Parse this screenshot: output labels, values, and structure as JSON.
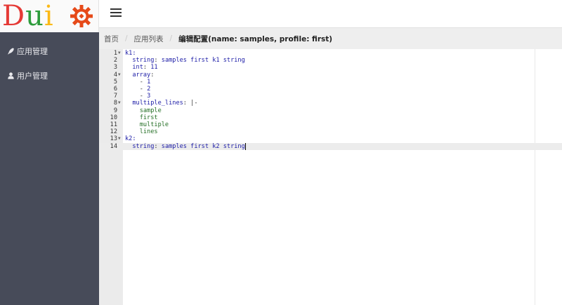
{
  "logo": {
    "letters": [
      "D",
      "u",
      "i"
    ],
    "colors": [
      "#e53935",
      "#2e9c3c",
      "#fbb917"
    ],
    "gear_color": "#e64a19"
  },
  "sidebar": {
    "items": [
      {
        "label": "应用管理",
        "icon": "rocket-icon"
      },
      {
        "label": "用户管理",
        "icon": "user-icon"
      }
    ]
  },
  "breadcrumb": {
    "items": [
      "首页",
      "应用列表"
    ],
    "current": "编辑配置(name: samples, profile: first)"
  },
  "editor": {
    "lines": [
      {
        "n": "1",
        "fold": true,
        "segs": [
          [
            "k",
            "k1:"
          ]
        ]
      },
      {
        "n": "2",
        "fold": false,
        "segs": [
          [
            "",
            "  "
          ],
          [
            "k",
            "string"
          ],
          [
            "",
            ": "
          ],
          [
            "s",
            "samples first k1 string"
          ]
        ]
      },
      {
        "n": "3",
        "fold": false,
        "segs": [
          [
            "",
            "  "
          ],
          [
            "k",
            "int"
          ],
          [
            "",
            ": "
          ],
          [
            "n",
            "11"
          ]
        ]
      },
      {
        "n": "4",
        "fold": true,
        "segs": [
          [
            "",
            "  "
          ],
          [
            "k",
            "array"
          ],
          [
            "",
            ":"
          ]
        ]
      },
      {
        "n": "5",
        "fold": false,
        "segs": [
          [
            "",
            "    "
          ],
          [
            "",
            "- "
          ],
          [
            "n",
            "1"
          ]
        ]
      },
      {
        "n": "6",
        "fold": false,
        "segs": [
          [
            "",
            "    "
          ],
          [
            "",
            "- "
          ],
          [
            "n",
            "2"
          ]
        ]
      },
      {
        "n": "7",
        "fold": false,
        "segs": [
          [
            "",
            "    "
          ],
          [
            "",
            "- "
          ],
          [
            "n",
            "3"
          ]
        ]
      },
      {
        "n": "8",
        "fold": true,
        "segs": [
          [
            "",
            "  "
          ],
          [
            "k",
            "multiple_lines"
          ],
          [
            "",
            ": "
          ],
          [
            "",
            "|-"
          ]
        ]
      },
      {
        "n": "9",
        "fold": false,
        "segs": [
          [
            "",
            "    "
          ],
          [
            "g",
            "sample"
          ]
        ]
      },
      {
        "n": "10",
        "fold": false,
        "segs": [
          [
            "",
            "    "
          ],
          [
            "g",
            "first"
          ]
        ]
      },
      {
        "n": "11",
        "fold": false,
        "segs": [
          [
            "",
            "    "
          ],
          [
            "g",
            "multiple"
          ]
        ]
      },
      {
        "n": "12",
        "fold": false,
        "segs": [
          [
            "",
            "    "
          ],
          [
            "g",
            "lines"
          ]
        ]
      },
      {
        "n": "13",
        "fold": true,
        "segs": [
          [
            "k",
            "k2:"
          ]
        ]
      },
      {
        "n": "14",
        "fold": false,
        "active": true,
        "segs": [
          [
            "",
            "  "
          ],
          [
            "k",
            "string"
          ],
          [
            "",
            ": "
          ],
          [
            "s",
            "samples first k2 string"
          ]
        ]
      }
    ]
  }
}
